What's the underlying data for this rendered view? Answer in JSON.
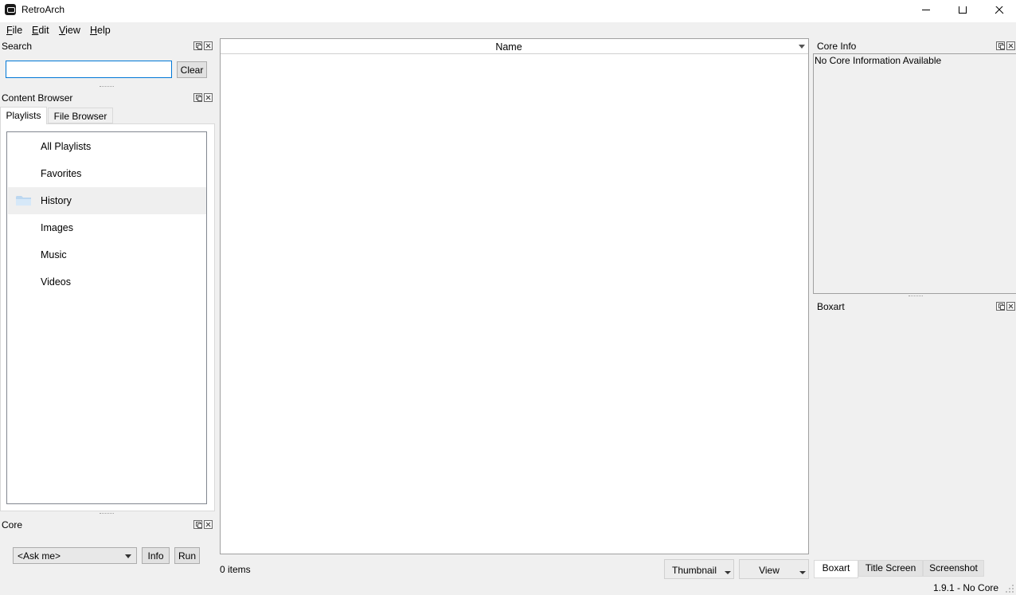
{
  "window": {
    "title": "RetroArch",
    "controls": [
      "minimize-icon",
      "maximize-icon",
      "close-icon"
    ]
  },
  "menu": [
    {
      "label": "File",
      "mnemonic": "F",
      "rest": "ile"
    },
    {
      "label": "Edit",
      "mnemonic": "E",
      "rest": "dit"
    },
    {
      "label": "View",
      "mnemonic": "V",
      "rest": "iew"
    },
    {
      "label": "Help",
      "mnemonic": "H",
      "rest": "elp"
    }
  ],
  "search": {
    "title": "Search",
    "input_value": "",
    "clear_label": "Clear"
  },
  "content_browser": {
    "title": "Content Browser",
    "tabs": [
      {
        "label": "Playlists",
        "active": true
      },
      {
        "label": "File Browser",
        "active": false
      }
    ],
    "playlists": [
      {
        "label": "All Playlists",
        "selected": false
      },
      {
        "label": "Favorites",
        "selected": false
      },
      {
        "label": "History",
        "selected": true,
        "icon": "folder-icon"
      },
      {
        "label": "Images",
        "selected": false
      },
      {
        "label": "Music",
        "selected": false
      },
      {
        "label": "Videos",
        "selected": false
      }
    ]
  },
  "core": {
    "title": "Core",
    "selected": "<Ask me>",
    "info_label": "Info",
    "run_label": "Run"
  },
  "table": {
    "column_name": "Name",
    "items_count": "0 items"
  },
  "toolbar": {
    "thumbnail_label": "Thumbnail",
    "view_label": "View"
  },
  "core_info": {
    "title": "Core Info",
    "text": "No Core Information Available"
  },
  "boxart": {
    "title": "Boxart",
    "tabs": [
      {
        "label": "Boxart",
        "active": true
      },
      {
        "label": "Title Screen",
        "active": false
      },
      {
        "label": "Screenshot",
        "active": false
      }
    ]
  },
  "status": {
    "version": "1.9.1 - No Core"
  },
  "colors": {
    "focus_border": "#0078d7",
    "background": "#f0f0f0",
    "selected_row": "#efefef"
  }
}
